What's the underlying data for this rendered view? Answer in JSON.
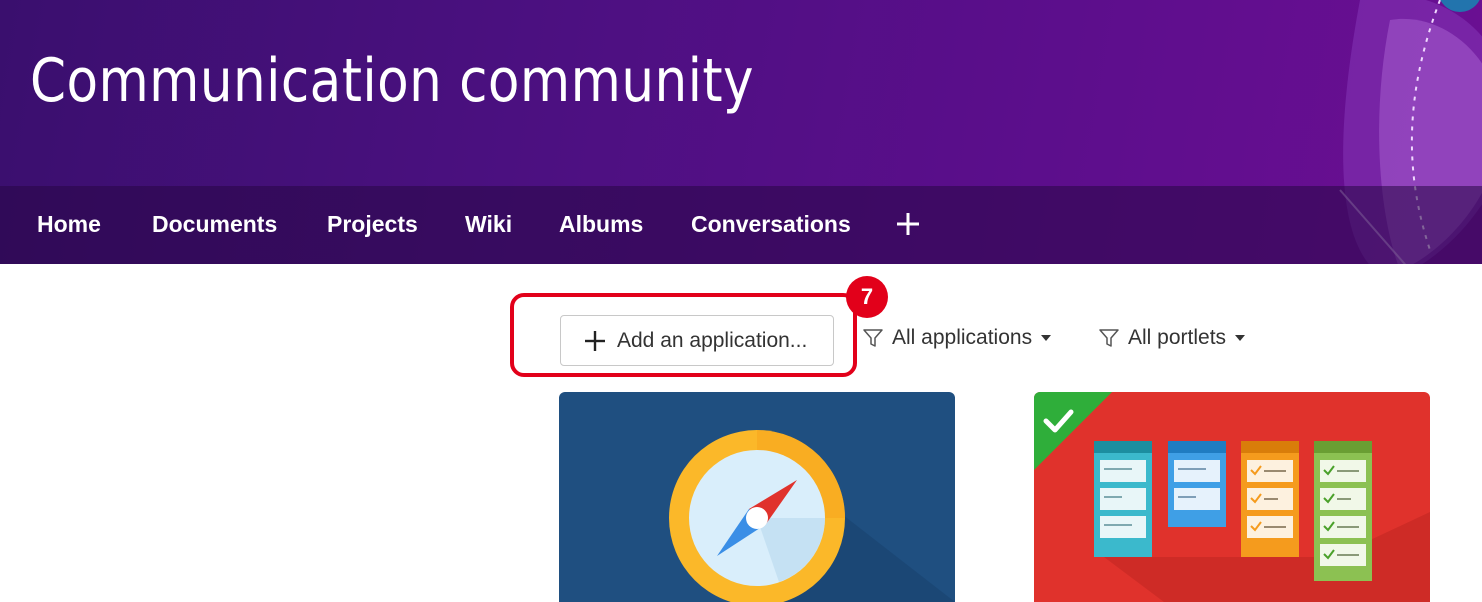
{
  "header": {
    "title": "Communication community"
  },
  "nav": {
    "items": [
      {
        "label": "Home"
      },
      {
        "label": "Documents"
      },
      {
        "label": "Projects"
      },
      {
        "label": "Wiki"
      },
      {
        "label": "Albums"
      },
      {
        "label": "Conversations"
      }
    ],
    "add_icon": "plus-icon"
  },
  "toolbar": {
    "step_badge": "7",
    "add_button_label": "Add an application...",
    "filter_applications": "All applications",
    "filter_portlets": "All portlets",
    "highlight_color": "#e2001a"
  },
  "cards": [
    {
      "icon": "compass-icon",
      "color": "#1f4f80",
      "installed": false
    },
    {
      "icon": "kanban-board-icon",
      "color": "#e0322c",
      "installed": true
    }
  ],
  "colors": {
    "banner": "#4b1080",
    "accent": "#e2001a",
    "installed_check": "#2fae3a"
  }
}
